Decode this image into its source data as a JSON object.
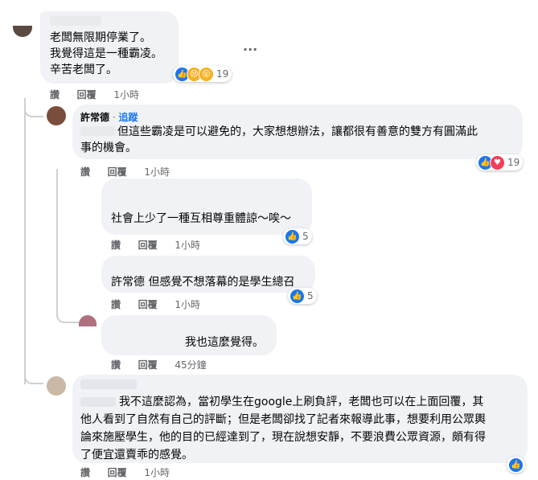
{
  "c1": {
    "text": "老闆無限期停業了。\n我覺得這是一種霸凌。\n辛苦老闆了。",
    "reaction_count": "19",
    "actions": {
      "like": "讚",
      "reply": "回覆",
      "time": "1小時"
    },
    "more": "···"
  },
  "c2": {
    "author": "許常德",
    "sep": "·",
    "follow": "追蹤",
    "text": "但這些霸凌是可以避免的，大家想想辦法，讓都很有善意的雙方有圓滿此\n事的機會。",
    "reaction_count": "19",
    "actions": {
      "like": "讚",
      "reply": "回覆",
      "time": "1小時"
    }
  },
  "c3": {
    "text": "社會上少了一種互相尊重體諒～唉～",
    "reaction_count": "5",
    "actions": {
      "like": "讚",
      "reply": "回覆",
      "time": "1小時"
    }
  },
  "c4": {
    "text": "許常德 但感覺不想落幕的是學生總召",
    "reaction_count": "5",
    "actions": {
      "like": "讚",
      "reply": "回覆",
      "time": "1小時"
    }
  },
  "c5": {
    "text": "我也這麼覺得。",
    "actions": {
      "like": "讚",
      "reply": "回覆",
      "time": "45分鐘"
    }
  },
  "c6": {
    "line1": "我不這麼認為，當初學生在google上刷負評，老闆也可以在上面回覆，其",
    "line2": "他人看到了自然有自己的評斷；但是老闆卻找了記者來報導此事，想要利用公眾輿",
    "line3": "論來施壓學生，他的目的已經達到了，現在說想安靜，不要浪費公眾資源，頗有得",
    "line4": "了便宜還賣乖的感覺。",
    "actions": {
      "like": "讚",
      "reply": "回覆",
      "time": "1小時"
    }
  },
  "colors": {
    "bubble": "#f0f2f5",
    "like": "#1877f2",
    "heart": "#f33e58",
    "meta": "#65676b"
  }
}
